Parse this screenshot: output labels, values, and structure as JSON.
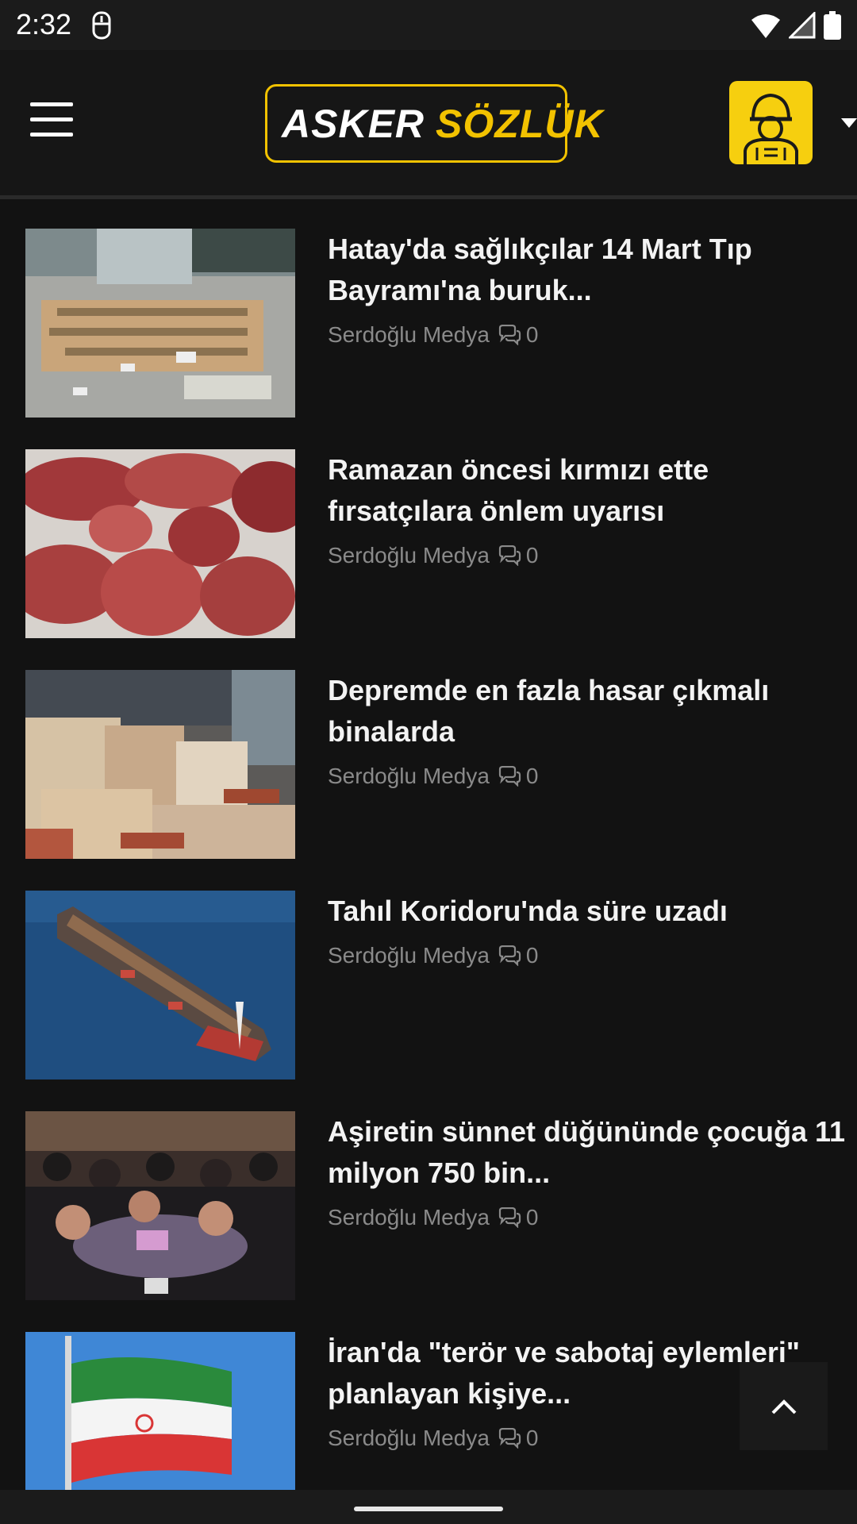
{
  "status_bar": {
    "time": "2:32",
    "icons": [
      "notification-icon",
      "wifi-icon",
      "signal-icon",
      "battery-icon"
    ]
  },
  "header": {
    "logo_word1": "ASKER",
    "logo_word2": "SÖZLÜK",
    "icons": [
      "menu-icon",
      "soldier-avatar-icon",
      "caret-down-icon"
    ],
    "colors": {
      "brand_yellow": "#f2c200",
      "background": "#121212"
    }
  },
  "articles": [
    {
      "title": "Hatay'da sağlıkçılar 14 Mart Tıp Bayramı'na buruk...",
      "author": "Serdoğlu Medya",
      "comments": "0"
    },
    {
      "title": "Ramazan öncesi kırmızı ette fırsatçılara önlem uyarısı",
      "author": "Serdoğlu Medya",
      "comments": "0"
    },
    {
      "title": "Depremde en fazla hasar çıkmalı binalarda",
      "author": "Serdoğlu Medya",
      "comments": "0"
    },
    {
      "title": "Tahıl Koridoru'nda süre uzadı",
      "author": "Serdoğlu Medya",
      "comments": "0"
    },
    {
      "title": "Aşiretin sünnet düğününde çocuğa 11 milyon 750 bin...",
      "author": "Serdoğlu Medya",
      "comments": "0"
    },
    {
      "title": "İran'da \"terör ve sabotaj eylemleri\" planlayan kişiye...",
      "author": "Serdoğlu Medya",
      "comments": "0"
    }
  ]
}
